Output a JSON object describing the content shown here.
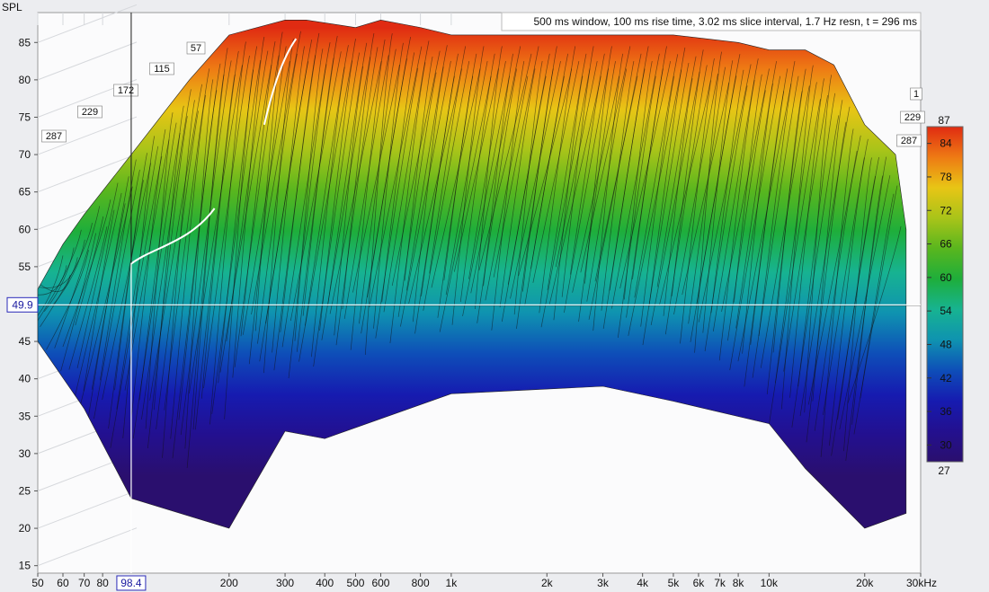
{
  "chart_data": {
    "type": "area",
    "subtype": "waterfall-3d",
    "ylabel": "SPL",
    "xunit": "kHz",
    "x_scale": "log",
    "xlim": [
      50,
      30000
    ],
    "ylim": [
      14,
      89
    ],
    "annotation": "500 ms window, 100 ms rise time, 3.02 ms slice interval, 1.7 Hz resn, t = 296 ms",
    "y_ticks": [
      {
        "value": 85,
        "label": "85"
      },
      {
        "value": 80,
        "label": "80"
      },
      {
        "value": 75,
        "label": "75"
      },
      {
        "value": 70,
        "label": "70"
      },
      {
        "value": 65,
        "label": "65"
      },
      {
        "value": 60,
        "label": "60"
      },
      {
        "value": 55,
        "label": "55"
      },
      {
        "value": 45,
        "label": "45"
      },
      {
        "value": 40,
        "label": "40"
      },
      {
        "value": 35,
        "label": "35"
      },
      {
        "value": 30,
        "label": "30"
      },
      {
        "value": 25,
        "label": "25"
      },
      {
        "value": 20,
        "label": "20"
      },
      {
        "value": 15,
        "label": "15"
      }
    ],
    "x_ticks": [
      {
        "value": 50,
        "label": "50"
      },
      {
        "value": 60,
        "label": "60"
      },
      {
        "value": 70,
        "label": "70"
      },
      {
        "value": 80,
        "label": "80"
      },
      {
        "value": 200,
        "label": "200"
      },
      {
        "value": 300,
        "label": "300"
      },
      {
        "value": 400,
        "label": "400"
      },
      {
        "value": 500,
        "label": "500"
      },
      {
        "value": 600,
        "label": "600"
      },
      {
        "value": 800,
        "label": "800"
      },
      {
        "value": 1000,
        "label": "1k"
      },
      {
        "value": 2000,
        "label": "2k"
      },
      {
        "value": 3000,
        "label": "3k"
      },
      {
        "value": 4000,
        "label": "4k"
      },
      {
        "value": 5000,
        "label": "5k"
      },
      {
        "value": 6000,
        "label": "6k"
      },
      {
        "value": 7000,
        "label": "7k"
      },
      {
        "value": 8000,
        "label": "8k"
      },
      {
        "value": 10000,
        "label": "10k"
      },
      {
        "value": 20000,
        "label": "20k"
      },
      {
        "value": 30000,
        "label": "30kHz"
      }
    ],
    "slice_time_labels": [
      "287",
      "229",
      "172",
      "115",
      "57"
    ],
    "right_slice_labels": [
      "287",
      "229",
      "1"
    ],
    "cursor": {
      "x_value": 98.4,
      "x_label": "98.4",
      "y_value": 49.9,
      "y_label": "49.9"
    },
    "envelope": {
      "x": [
        50,
        60,
        70,
        98.4,
        150,
        200,
        300,
        350,
        500,
        600,
        800,
        1000,
        2000,
        3000,
        5000,
        8000,
        10000,
        13000,
        16000,
        20000,
        25000,
        27000
      ],
      "spl": [
        52,
        58,
        62,
        70,
        80,
        86,
        88,
        88,
        87,
        88,
        87,
        86,
        86,
        86,
        86,
        85,
        84,
        84,
        82,
        74,
        70,
        60
      ]
    },
    "floor": {
      "x": [
        50,
        70,
        98.4,
        200,
        300,
        400,
        1000,
        3000,
        5000,
        10000,
        13000,
        20000,
        27000
      ],
      "spl": [
        45,
        36,
        24,
        20,
        33,
        32,
        38,
        39,
        37,
        34,
        28,
        20,
        22
      ]
    },
    "colorbar": {
      "min_label": "27",
      "max_label": "87",
      "range": [
        27,
        87
      ],
      "ticks": [
        {
          "value": 84,
          "label": "84"
        },
        {
          "value": 78,
          "label": "78"
        },
        {
          "value": 72,
          "label": "72"
        },
        {
          "value": 66,
          "label": "66"
        },
        {
          "value": 60,
          "label": "60"
        },
        {
          "value": 54,
          "label": "54"
        },
        {
          "value": 48,
          "label": "48"
        },
        {
          "value": 42,
          "label": "42"
        },
        {
          "value": 36,
          "label": "36"
        },
        {
          "value": 30,
          "label": "30"
        }
      ],
      "colors": [
        "#2a0f6e",
        "#23108f",
        "#161bb0",
        "#0e4eb8",
        "#0f93b0",
        "#17b391",
        "#1eae3b",
        "#59b61e",
        "#a9c419",
        "#e8c515",
        "#ee7a14",
        "#e02b12"
      ]
    },
    "grid": true,
    "legend": "colorbar-right"
  }
}
